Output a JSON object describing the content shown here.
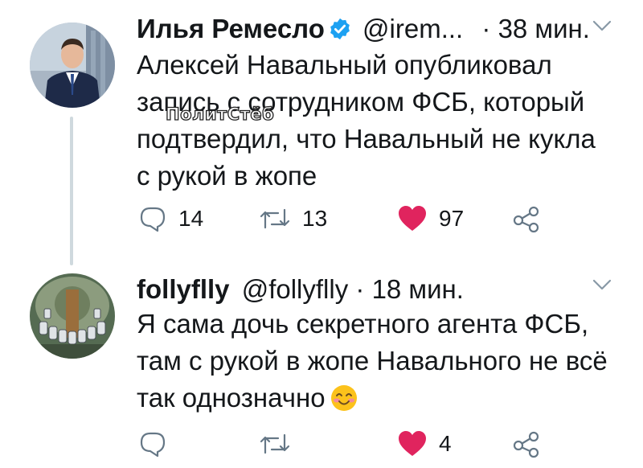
{
  "tweets": [
    {
      "name": "Илья Ремесло",
      "handle": "@irem...",
      "separator": "·",
      "time": "38 мин.",
      "text_lines": [
        "Алексей Навальный опубликовал",
        "запись с сотрудником ФСБ, который",
        "подтвердил, что Навальный не кукла",
        "с рукой в жопе"
      ],
      "watermark": "ПолитСтёб",
      "actions": {
        "replies": "14",
        "retweets": "13",
        "likes": "97"
      }
    },
    {
      "name": "follyflly",
      "handle": "@follyflly",
      "separator": "·",
      "time": "18 мин.",
      "text_lines": [
        "Я сама дочь секретного агента ФСБ,",
        "там с рукой в жопе Навального не всё",
        "так однозначно"
      ],
      "actions": {
        "replies": "",
        "retweets": "",
        "likes": "4"
      }
    }
  ],
  "colors": {
    "verified": "#1da1f2",
    "like": "#e0245e",
    "icon": "#657786",
    "thread": "#cfd9de"
  },
  "icons": [
    "verified-icon",
    "chevron-down-icon",
    "reply-icon",
    "retweet-icon",
    "heart-icon",
    "share-icon",
    "smiling-face-emoji"
  ]
}
